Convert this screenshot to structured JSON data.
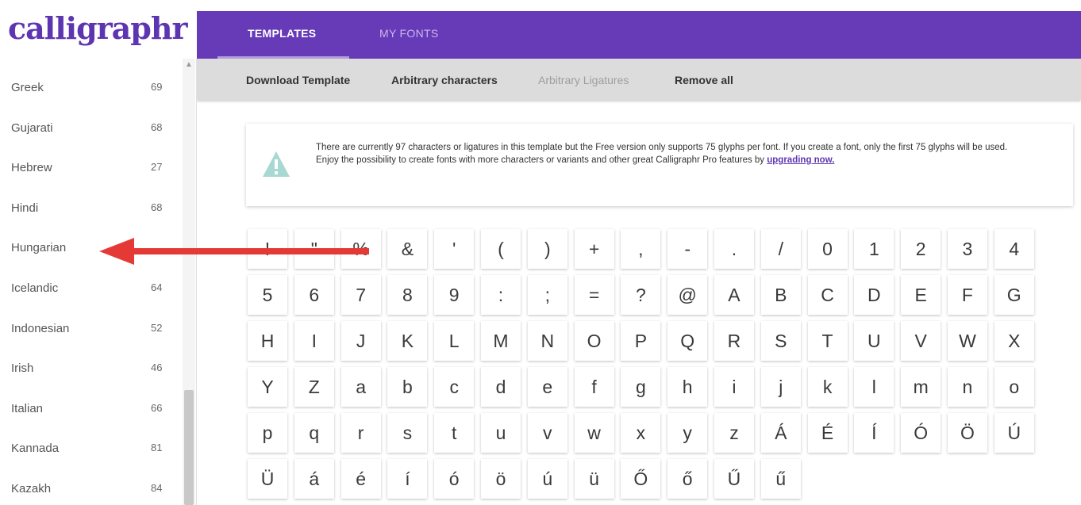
{
  "app": {
    "logo_text": "calligraphr",
    "brand_color": "#673ab7"
  },
  "tabs": [
    {
      "label": "TEMPLATES",
      "active": true
    },
    {
      "label": "MY FONTS",
      "active": false
    }
  ],
  "toolbar": {
    "download_template": "Download Template",
    "arbitrary_characters": "Arbitrary characters",
    "arbitrary_ligatures": "Arbitrary Ligatures",
    "remove_all": "Remove all"
  },
  "sidebar": {
    "items": [
      {
        "label": "Greek",
        "count": "69"
      },
      {
        "label": "Gujarati",
        "count": "68"
      },
      {
        "label": "Hebrew",
        "count": "27"
      },
      {
        "label": "Hindi",
        "count": "68"
      },
      {
        "label": "Hungarian",
        "count": ""
      },
      {
        "label": "Icelandic",
        "count": "64"
      },
      {
        "label": "Indonesian",
        "count": "52"
      },
      {
        "label": "Irish",
        "count": "46"
      },
      {
        "label": "Italian",
        "count": "66"
      },
      {
        "label": "Kannada",
        "count": "81"
      },
      {
        "label": "Kazakh",
        "count": "84"
      }
    ]
  },
  "notice": {
    "line1": "There are currently 97 characters or ligatures in this template but the Free version only supports 75 glyphs per font. If you create a font, only the first 75 glyphs will be used.",
    "line2": "Enjoy the possibility to create fonts with more characters or variants and other great Calligraphr Pro features by ",
    "link": "upgrading now.",
    "icon": "warning-triangle-icon"
  },
  "glyphs": [
    "!",
    "\"",
    "%",
    "&",
    "'",
    "(",
    ")",
    "+",
    ",",
    "-",
    ".",
    "/",
    "0",
    "1",
    "2",
    "3",
    "4",
    "5",
    "6",
    "7",
    "8",
    "9",
    ":",
    ";",
    "=",
    "?",
    "@",
    "A",
    "B",
    "C",
    "D",
    "E",
    "F",
    "G",
    "H",
    "I",
    "J",
    "K",
    "L",
    "M",
    "N",
    "O",
    "P",
    "Q",
    "R",
    "S",
    "T",
    "U",
    "V",
    "W",
    "X",
    "Y",
    "Z",
    "a",
    "b",
    "c",
    "d",
    "e",
    "f",
    "g",
    "h",
    "i",
    "j",
    "k",
    "l",
    "m",
    "n",
    "o",
    "p",
    "q",
    "r",
    "s",
    "t",
    "u",
    "v",
    "w",
    "x",
    "y",
    "z",
    "Á",
    "É",
    "Í",
    "Ó",
    "Ö",
    "Ú",
    "Ü",
    "á",
    "é",
    "í",
    "ó",
    "ö",
    "ú",
    "ü",
    "Ő",
    "ő",
    "Ű",
    "ű"
  ],
  "annotation": {
    "icon": "red-arrow-icon",
    "color": "#e53935"
  }
}
